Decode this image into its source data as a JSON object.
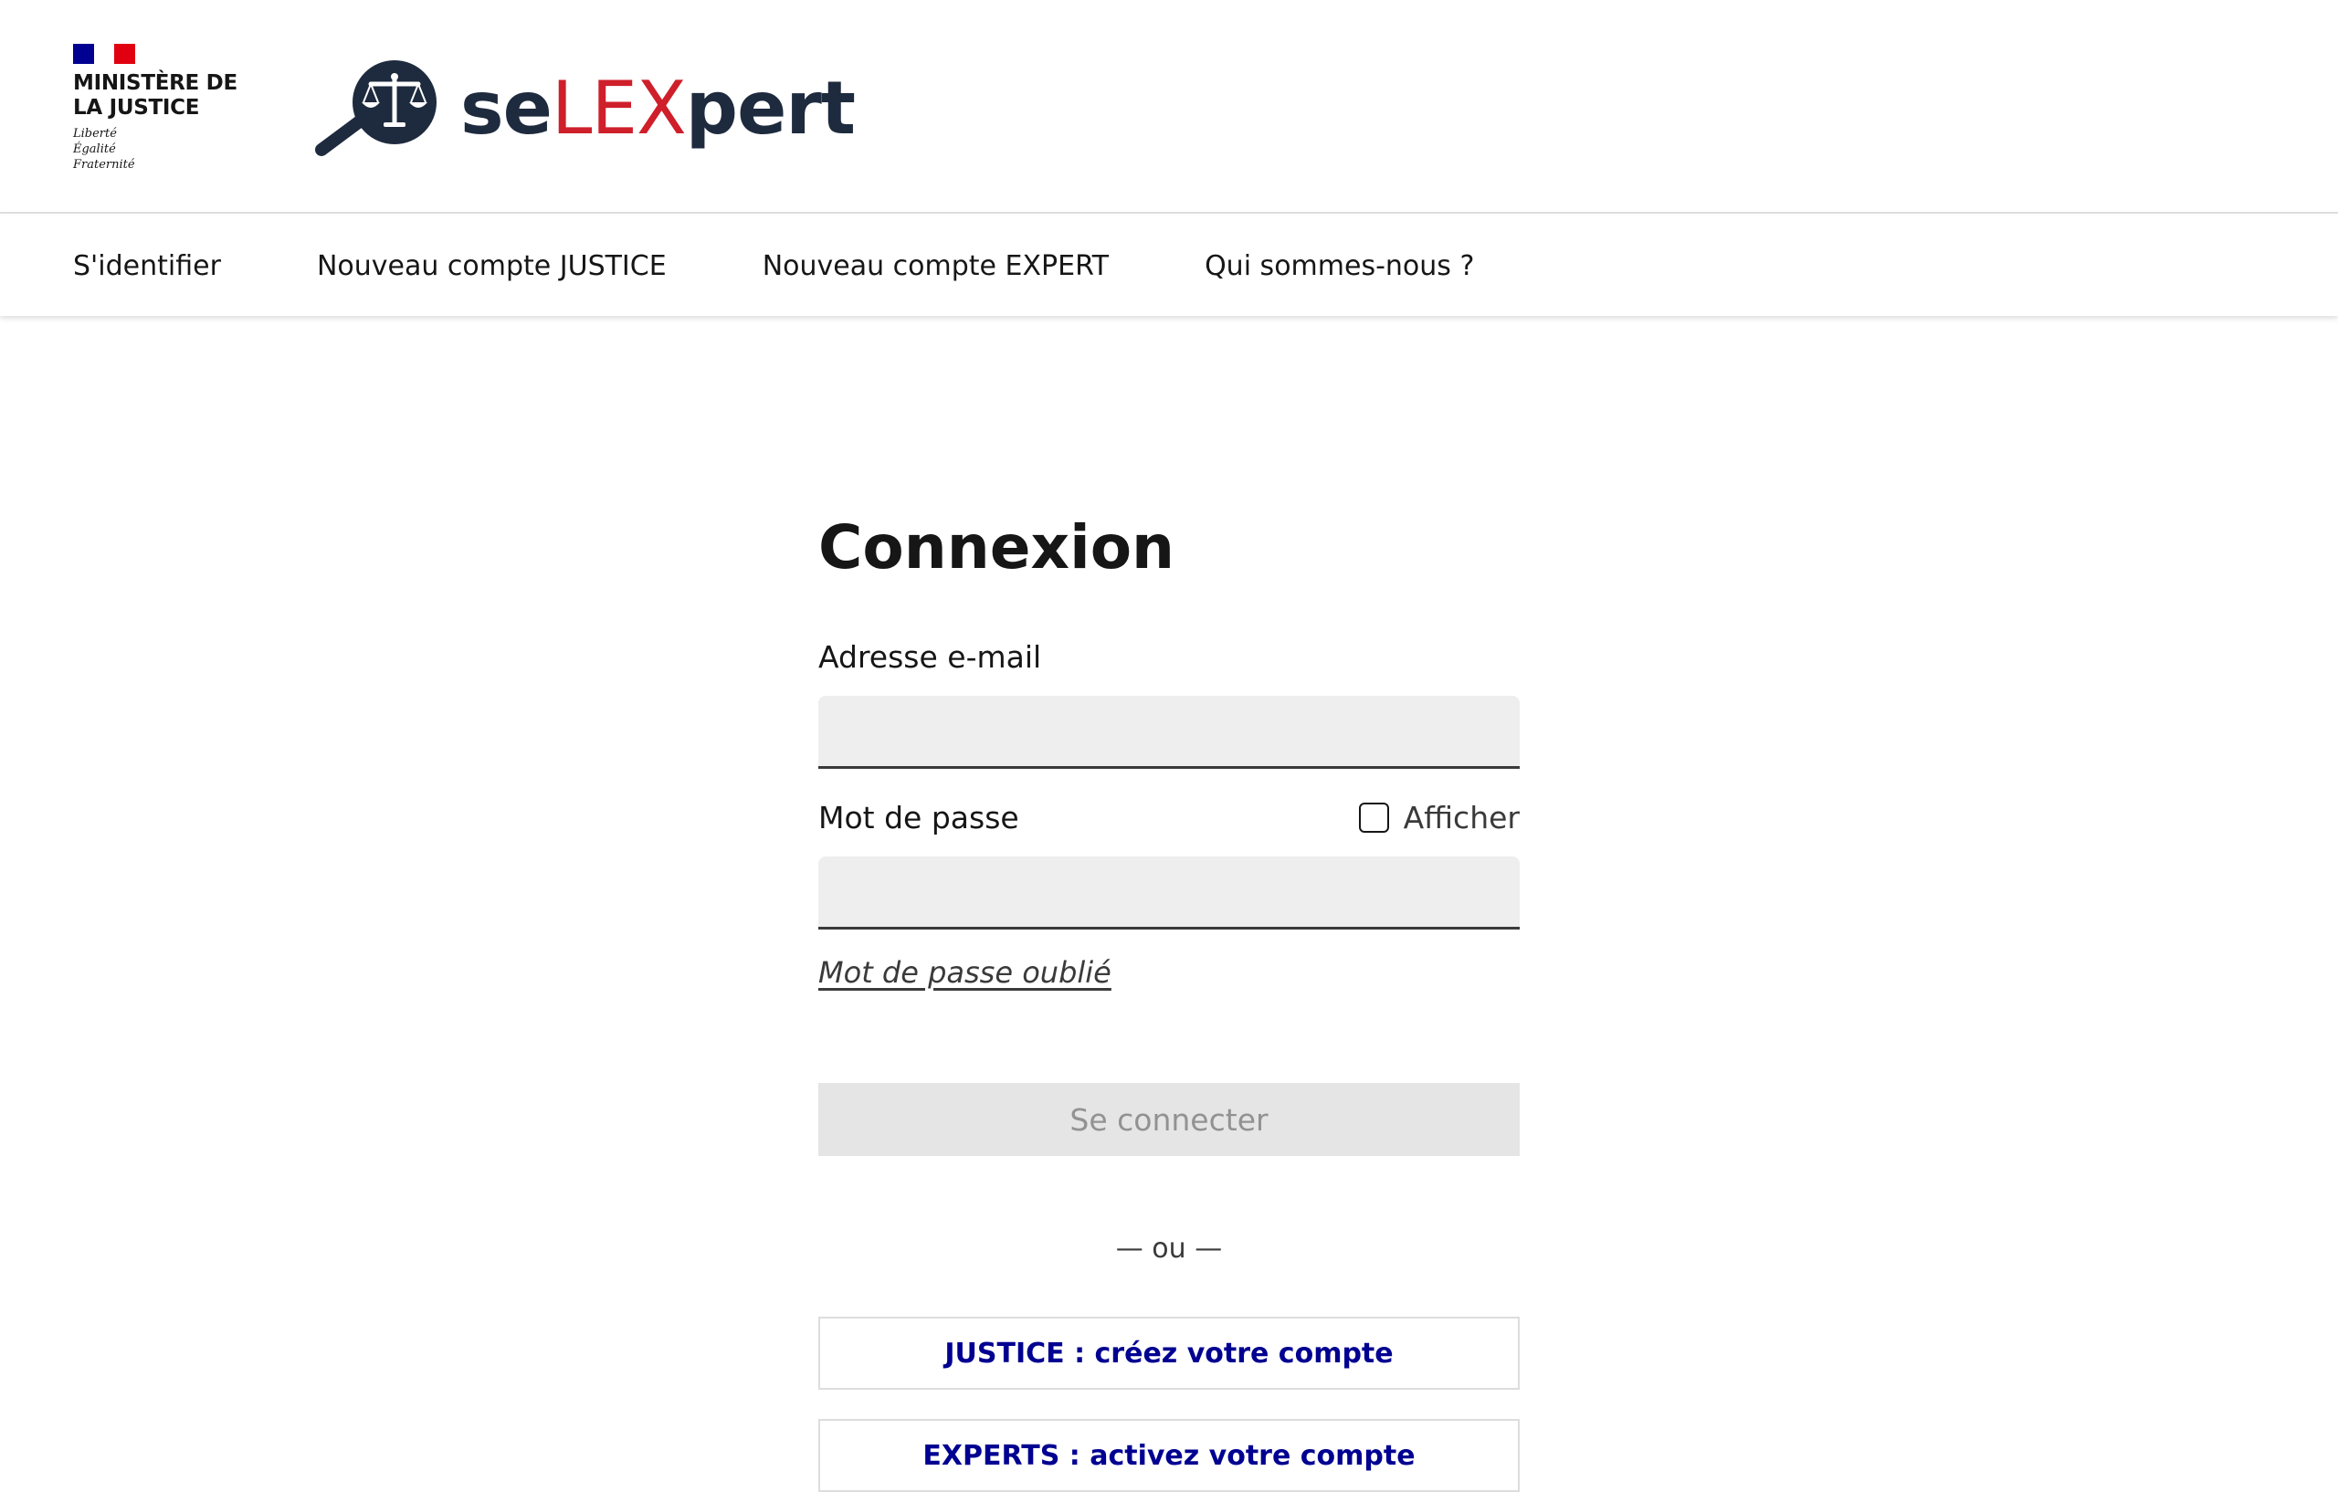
{
  "header": {
    "ministry": {
      "line1": "MINISTÈRE DE",
      "line2": "LA JUSTICE",
      "motto": [
        "Liberté",
        "Égalité",
        "Fraternité"
      ],
      "flag_colors": [
        "#000091",
        "#ffffff",
        "#e1000f"
      ]
    },
    "brand": {
      "prefix": "se",
      "middle": "LEX",
      "suffix": "pert",
      "icon": "magnifier-scales-icon",
      "colors": {
        "dark": "#1e2a3e",
        "accent": "#ce1f2a"
      }
    }
  },
  "nav": {
    "items": [
      {
        "label": "S'identifier"
      },
      {
        "label": "Nouveau compte JUSTICE"
      },
      {
        "label": "Nouveau compte EXPERT"
      },
      {
        "label": "Qui sommes-nous ?"
      }
    ]
  },
  "login": {
    "title": "Connexion",
    "email_label": "Adresse e-mail",
    "email_value": "",
    "password_label": "Mot de passe",
    "password_value": "",
    "show_password_label": "Afficher",
    "show_password_checked": false,
    "forgot_password": "Mot de passe oublié",
    "submit_label": "Se connecter",
    "separator": "— ou —",
    "justice_button": "JUSTICE : créez votre compte",
    "experts_button": "EXPERTS : activez votre compte"
  },
  "colors": {
    "primary_blue": "#000091",
    "text": "#161616",
    "disabled_bg": "#e5e5e5",
    "disabled_text": "#929292"
  }
}
